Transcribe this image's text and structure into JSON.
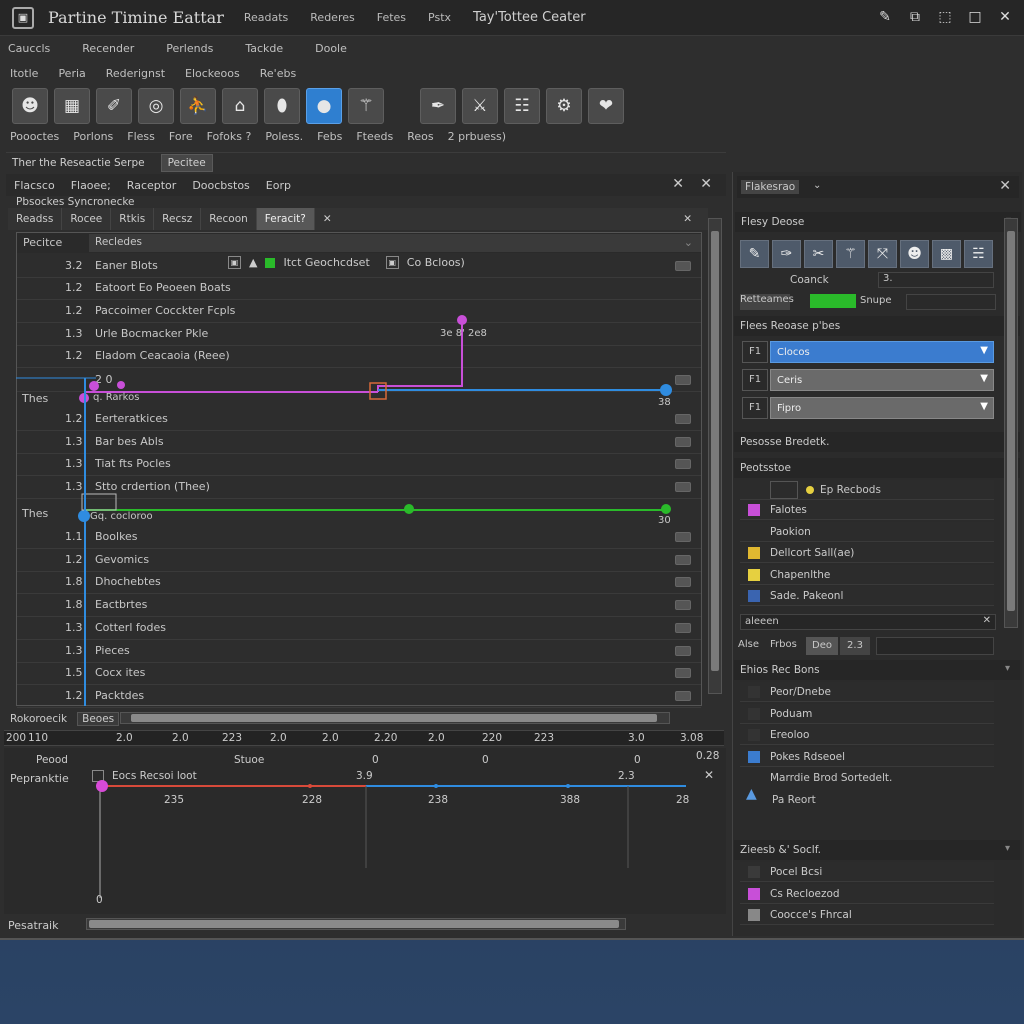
{
  "app": {
    "title": "Partine Timine Eattar",
    "title_tabs": [
      "Readats",
      "Rederes",
      "Fetes",
      "Pstx"
    ],
    "title_tab_main": "Tay'Tottee Ceater",
    "window_controls": [
      "pin-icon",
      "restore-icon",
      "tile-icon",
      "maximize-icon",
      "close-icon"
    ]
  },
  "menu1": [
    "Cauccls",
    "Recender",
    "Perlends",
    "Tackde",
    "Doole"
  ],
  "menu2": [
    "Itotle",
    "Peria",
    "Rederignst",
    "Elockeoos",
    "Re'ebs"
  ],
  "toolbar": {
    "icons": [
      "user-icon",
      "frame-icon",
      "brush-icon",
      "circle-icon",
      "walk-icon",
      "camera-icon",
      "shape-icon",
      "record-icon",
      "wand-icon",
      "feather-icon",
      "pens-icon",
      "grid-icon",
      "gear-icon",
      "heart-icon"
    ],
    "labels": [
      "Poooctes",
      "Porlons",
      "Fless",
      "Fore",
      "Fofoks ?",
      "Poless.",
      "Febs",
      "Fteeds",
      "Reos",
      "2 prbuess)"
    ]
  },
  "panel_tabs": {
    "main": "Ther the Reseactie Serpe",
    "secondary": "Pecitee"
  },
  "editor": {
    "header_items": [
      "Flacsco",
      "Flaoee;",
      "Raceptor",
      "Doocbstos",
      "Eorp"
    ],
    "sub_header": "Pbsockes Syncronecke",
    "filter_items": [
      "Readss",
      "Rocee",
      "Rtkis",
      "Recsz",
      "Recoon",
      "Feracit?"
    ],
    "col_lane": "Pecitce",
    "col_track": "Recledes",
    "inline_label": "Itct Geochcdset",
    "inline_label2": "Co Bcloos)",
    "point_label_1": "3e 8' 2e8",
    "point_label_2": "38",
    "point_label_3": "30",
    "lane_label_1": "Thes",
    "lane_label_2": "Thes",
    "lane_sub_1": "q. Rarkos",
    "lane_sub_2": "Gq. cocloroo",
    "rows": [
      {
        "num": "3.2",
        "name": "Eaner Blots"
      },
      {
        "num": "1.2",
        "name": "Eatoort  Eo Peoeen Boats"
      },
      {
        "num": "1.2",
        "name": "Paccoimer  Cocckter Fcpls"
      },
      {
        "num": "1.3",
        "name": "Urle  Bocmacker Pkle"
      },
      {
        "num": "1.2",
        "name": "Eladom Ceacaoia (Reee)"
      },
      {
        "num": "",
        "name": "2 0"
      },
      {
        "num": "1.2",
        "name": "Eerteratkices"
      },
      {
        "num": "1.3",
        "name": "Bar bes Abls"
      },
      {
        "num": "1.3",
        "name": "Tiat fts  Pocles"
      },
      {
        "num": "1.3",
        "name": "Stto crdertion (Thee)"
      },
      {
        "num": "1.1",
        "name": "Boolkes"
      },
      {
        "num": "1.2",
        "name": "Gevomics"
      },
      {
        "num": "1.8",
        "name": "Dhochebtes"
      },
      {
        "num": "1.8",
        "name": "Eactbrtes"
      },
      {
        "num": "1.3",
        "name": "Cotterl fodes"
      },
      {
        "num": "1.3",
        "name": "Pieces"
      },
      {
        "num": "1.5",
        "name": "Cocx ites"
      },
      {
        "num": "1.2",
        "name": "Packtdes"
      }
    ]
  },
  "timeline": {
    "scroll_label": "Rokoroecik",
    "scroll_btn": "Beoes",
    "ruler": [
      "200",
      "110",
      "2.0",
      "2.0",
      "223",
      "2.0",
      "2.0",
      "2.20",
      "2.0",
      "220",
      "223",
      "3.0",
      "3.08"
    ],
    "sub_labels": [
      "Peood",
      "Stuoe",
      "0",
      "0",
      "0",
      "0.28"
    ],
    "lower_label": "Pepranktie",
    "lower_track": "Eocs Recsoi loot",
    "lower_marks": [
      "3.9",
      "2.3"
    ],
    "lower_values": [
      "235",
      "228",
      "238",
      "388",
      "28"
    ],
    "lower_zero": "0",
    "bottom_label": "Pesatraik"
  },
  "right_panel": {
    "tab": "Flakesrao",
    "section1": "Flesy Deose",
    "field1": "Coanck",
    "field1b": "3.",
    "field2": "Retteames",
    "field2_value": "Snupe",
    "section2": "Flees  Reoase p'bes",
    "dropdowns": [
      {
        "num": "F1",
        "value": "Clocos"
      },
      {
        "num": "F1",
        "value": "Ceris"
      },
      {
        "num": "F1",
        "value": "Fipro"
      }
    ],
    "section3": "Pesosse Bredetk.",
    "section4": "Peotsstoe",
    "list_header": "Ep Recbods",
    "list": [
      {
        "label": "Falotes",
        "color": "#c84fd8"
      },
      {
        "label": "Paokion",
        "color": "#2c2c2c"
      },
      {
        "label": "Dellcort Sall(ae)",
        "color": "#e0b830"
      },
      {
        "label": "Chapenlthe",
        "color": "#e6d040"
      },
      {
        "label": "Sade. Pakeonl",
        "color": "#3a64b0"
      }
    ],
    "search_label": "aleeen",
    "section5_a": "Alse",
    "section5_b": "Frbos",
    "section5_c": "Deo",
    "section5_d": "2.3",
    "section6": "Ehios Rec Bons",
    "list2": [
      "Peor/Dnebe",
      "Poduam",
      "Ereoloo",
      "Pokes Rdseoel"
    ],
    "note1": "Marrdie Brod Sortedelt.",
    "note2": "Pa Reort",
    "section7": "Zieesb &' Soclf.",
    "list3": [
      {
        "label": "Pocel Bcsi",
        "color": "#3a3a3a"
      },
      {
        "label": "Cs Recloezod",
        "color": "#c84fd8"
      },
      {
        "label": "Coocce's Fhrcal",
        "color": "#888888"
      }
    ]
  },
  "colors": {
    "accent_blue": "#2f7fd0",
    "track_magenta": "#c84fd8",
    "track_blue": "#2f8ce0",
    "track_green": "#2aba2a",
    "track_red": "#d84a3a"
  }
}
